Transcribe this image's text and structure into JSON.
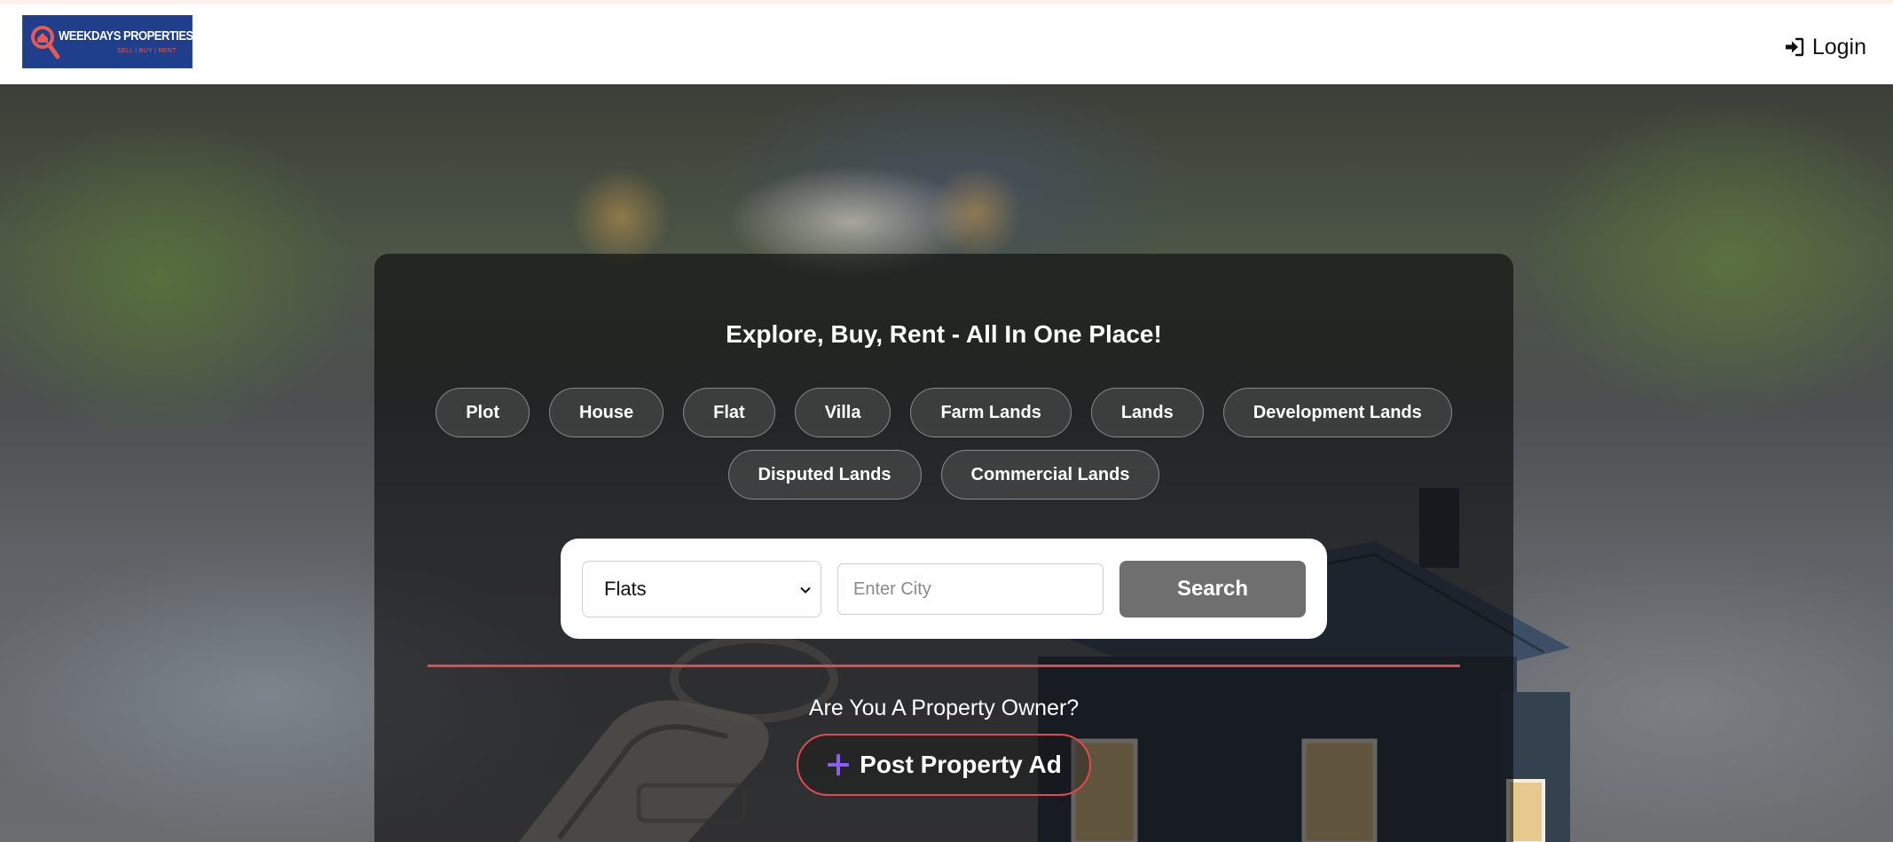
{
  "header": {
    "logo": {
      "name": "WEEKDAYS PROPERTIES",
      "tagline": "SELL | BUY | RENT"
    },
    "login_label": "Login"
  },
  "hero": {
    "title": "Explore, Buy, Rent - All In One Place!",
    "categories": [
      "Plot",
      "House",
      "Flat",
      "Villa",
      "Farm Lands",
      "Lands",
      "Development Lands",
      "Disputed Lands",
      "Commercial Lands"
    ],
    "search": {
      "property_type_selected": "Flats",
      "city_placeholder": "Enter City",
      "button_label": "Search"
    },
    "owner_prompt": "Are You A Property Owner?",
    "post_button_label": "Post Property Ad"
  },
  "colors": {
    "brand_blue": "#1f3f8c",
    "accent_red": "#e5484d",
    "search_button": "#6f6f6f",
    "plus_icon": "#8b5cf6"
  }
}
